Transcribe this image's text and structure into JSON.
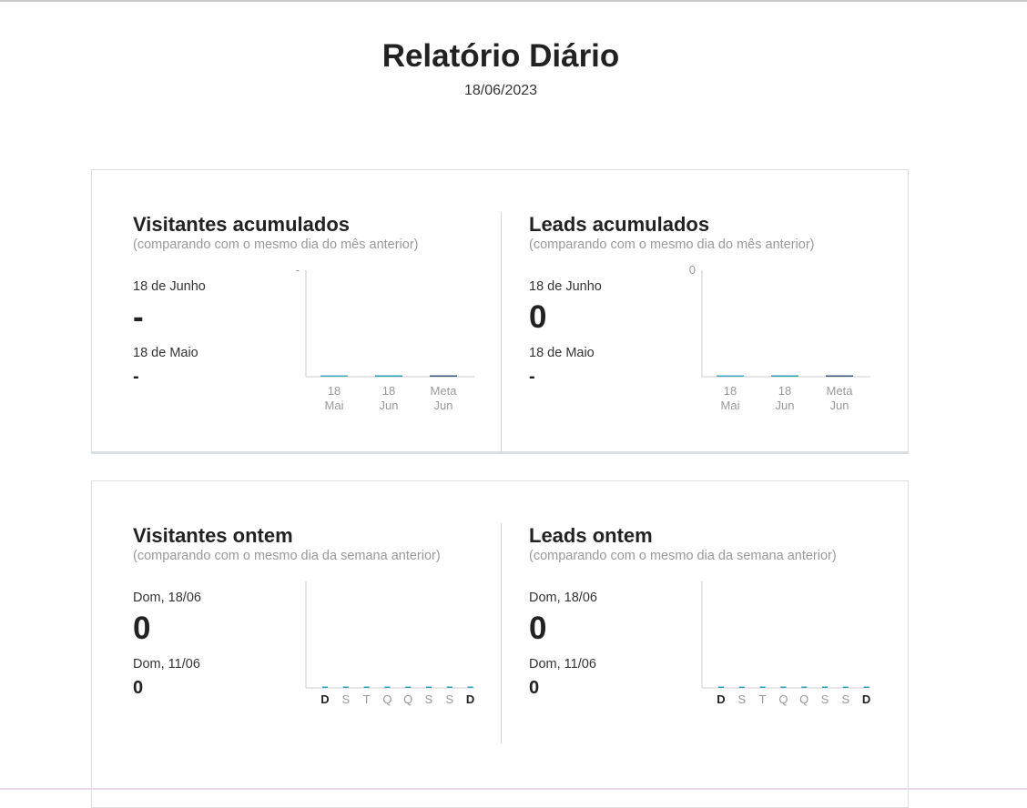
{
  "report": {
    "title": "Relatório Diário",
    "date": "18/06/2023"
  },
  "colors": {
    "bar_mai": "#3fa9c4",
    "bar_jun": "#2a9fb8",
    "bar_meta": "#3a5a80",
    "axis": "#cccccc",
    "weekday_bar": "#2a9fb8"
  },
  "cards": [
    {
      "panels": [
        {
          "title": "Visitantes acumulados",
          "subtitle": "(comparando com o mesmo dia do mês anterior)",
          "current_label": "18 de Junho",
          "current_value": "-",
          "previous_label": "18 de Maio",
          "previous_value": "-",
          "chart_data": {
            "type": "bar",
            "categories": [
              [
                "18",
                "Mai"
              ],
              [
                "18",
                "Jun"
              ],
              [
                "Meta",
                "Jun"
              ]
            ],
            "values": [
              0,
              0,
              0
            ],
            "y_max_label": "-"
          }
        },
        {
          "title": "Leads acumulados",
          "subtitle": "(comparando com o mesmo dia do mês anterior)",
          "current_label": "18 de Junho",
          "current_value": "0",
          "previous_label": "18 de Maio",
          "previous_value": "-",
          "chart_data": {
            "type": "bar",
            "categories": [
              [
                "18",
                "Mai"
              ],
              [
                "18",
                "Jun"
              ],
              [
                "Meta",
                "Jun"
              ]
            ],
            "values": [
              0,
              0,
              0
            ],
            "y_max_label": "0"
          }
        }
      ]
    },
    {
      "panels": [
        {
          "title": "Visitantes ontem",
          "subtitle": "(comparando com o mesmo dia da semana anterior)",
          "current_label": "Dom, 18/06",
          "current_value": "0",
          "previous_label": "Dom, 11/06",
          "previous_value": "0",
          "chart_data": {
            "type": "bar",
            "categories": [
              "D",
              "S",
              "T",
              "Q",
              "Q",
              "S",
              "S",
              "D"
            ],
            "highlighted": [
              0,
              7
            ],
            "values": [
              0,
              0,
              0,
              0,
              0,
              0,
              0,
              0
            ]
          }
        },
        {
          "title": "Leads ontem",
          "subtitle": "(comparando com o mesmo dia da semana anterior)",
          "current_label": "Dom, 18/06",
          "current_value": "0",
          "previous_label": "Dom, 11/06",
          "previous_value": "0",
          "chart_data": {
            "type": "bar",
            "categories": [
              "D",
              "S",
              "T",
              "Q",
              "Q",
              "S",
              "S",
              "D"
            ],
            "highlighted": [
              0,
              7
            ],
            "values": [
              0,
              0,
              0,
              0,
              0,
              0,
              0,
              0
            ]
          }
        }
      ]
    }
  ]
}
